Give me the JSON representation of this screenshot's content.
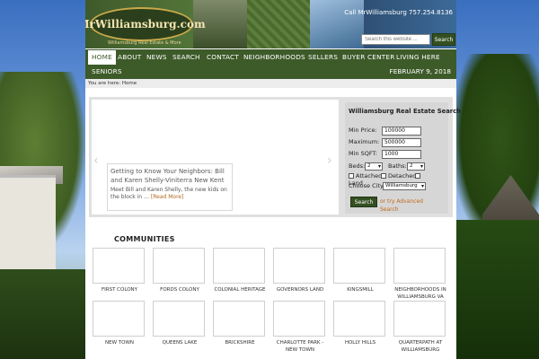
{
  "header": {
    "logo": "MrWilliamsburg.com",
    "logo_tagline": "Williamsburg Real Estate & More",
    "phone": "Call MrWilliamsburg 757.254.8136",
    "search_placeholder": "Search this website ...",
    "search_button": "Search"
  },
  "nav": {
    "items": [
      "HOME",
      "ABOUT",
      "NEWS",
      "SEARCH",
      "CONTACT",
      "NEIGHBORHOODS",
      "SELLERS",
      "BUYER CENTER",
      "LIVING HERE",
      "SENIORS"
    ],
    "date": "FEBRUARY 9, 2018"
  },
  "breadcrumb": "You are here: Home",
  "slider": {
    "title": "Getting to Know Your Neighbors: Bill and Karen Shelly-Viniterra New Kent",
    "excerpt": "Meet Bill and Karen Shelly, the new kids on the block in …",
    "read_more": "[Read More]"
  },
  "re_search": {
    "title": "Williamsburg Real Estate Search",
    "min_price_label": "Min Price:",
    "min_price": "100000",
    "maximum_label": "Maximum:",
    "maximum": "500000",
    "min_sqft_label": "Min SQFT:",
    "min_sqft": "1000",
    "beds_label": "Beds:",
    "beds": "2",
    "baths_label": "Baths:",
    "baths": "2",
    "attached_label": "Attached",
    "detached_label": "Detached",
    "land_label": "Land",
    "choose_city_label": "Choose City",
    "city": "Williamsburg",
    "search_button": "Search",
    "advanced_link": "or try Advanced Search"
  },
  "communities": {
    "title": "COMMUNITIES",
    "items": [
      "FIRST COLONY",
      "FORDS COLONY",
      "COLONIAL HERITAGE",
      "GOVERNORS LAND",
      "KINGSMILL",
      "NEIGHBORHOODS IN WILLIAMSBURG VA",
      "NEW TOWN",
      "QUEENS LAKE",
      "BRICKSHIRE",
      "CHARLOTTE PARK - NEW TOWN",
      "HOLLY HILLS",
      "QUARTERPATH AT WILLIAMSBURG"
    ]
  },
  "colors": {
    "nav_green": "#3d5a29",
    "button_green": "#345021",
    "link_orange": "#c26a1c",
    "background_blue": "#6b8fc9"
  }
}
